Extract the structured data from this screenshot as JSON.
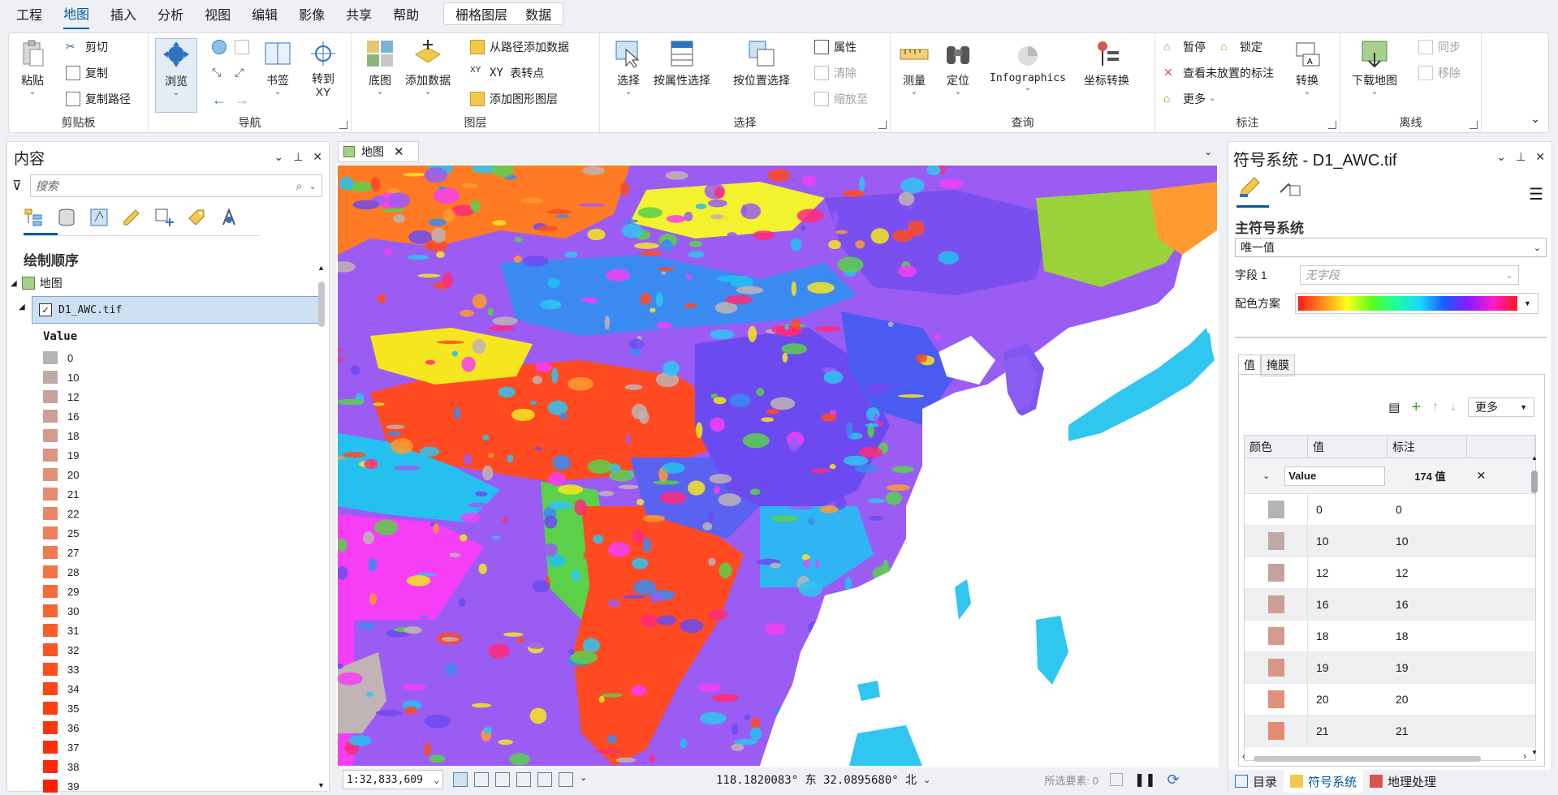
{
  "menubar": {
    "items": [
      "工程",
      "地图",
      "插入",
      "分析",
      "视图",
      "编辑",
      "影像",
      "共享",
      "帮助"
    ],
    "active": "地图",
    "context": [
      "栅格图层",
      "数据"
    ]
  },
  "ribbon": {
    "clipboard": {
      "label": "剪贴板",
      "paste": "粘贴",
      "cut": "剪切",
      "copy": "复制",
      "copy_path": "复制路径"
    },
    "navigate": {
      "label": "导航",
      "explore": "浏览",
      "bookmarks": "书签",
      "goto_xy": "转到\nXY"
    },
    "layer": {
      "label": "图层",
      "basemap": "底图",
      "add_data": "添加数据",
      "add_from_path": "从路径添加数据",
      "xy_to_point": "表转点",
      "add_graphics": "添加图形图层"
    },
    "selection": {
      "label": "选择",
      "select": "选择",
      "by_attr": "按属性选择",
      "by_location": "按位置选择",
      "attributes": "属性",
      "clear": "清除",
      "zoom_to": "缩放至"
    },
    "inquiry": {
      "label": "查询",
      "measure": "测量",
      "locate": "定位",
      "infographics": "Infographics",
      "coord_convert": "坐标转换"
    },
    "labeling": {
      "label": "标注",
      "pause": "暂停",
      "lock": "锁定",
      "unplaced": "查看未放置的标注",
      "more": "更多",
      "convert": "转换"
    },
    "offline": {
      "label": "离线",
      "download": "下载地图",
      "sync": "同步",
      "remove": "移除"
    }
  },
  "contents": {
    "title": "内容",
    "search_placeholder": "搜索",
    "draw_order": "绘制顺序",
    "map_name": "地图",
    "layer_name": "D1_AWC.tif",
    "legend_field": "Value",
    "legend": [
      {
        "value": "0",
        "color": "#b4b4b4"
      },
      {
        "value": "10",
        "color": "#bfa9a6"
      },
      {
        "value": "12",
        "color": "#c5a39d"
      },
      {
        "value": "16",
        "color": "#cc9f96"
      },
      {
        "value": "18",
        "color": "#d39b8d"
      },
      {
        "value": "19",
        "color": "#d99685"
      },
      {
        "value": "20",
        "color": "#e0917a"
      },
      {
        "value": "21",
        "color": "#e48b70"
      },
      {
        "value": "22",
        "color": "#e88666"
      },
      {
        "value": "25",
        "color": "#eb805b"
      },
      {
        "value": "27",
        "color": "#ef7a51"
      },
      {
        "value": "28",
        "color": "#f27347"
      },
      {
        "value": "29",
        "color": "#f46c3e"
      },
      {
        "value": "30",
        "color": "#f66535"
      },
      {
        "value": "31",
        "color": "#f75e2d"
      },
      {
        "value": "32",
        "color": "#f85625"
      },
      {
        "value": "33",
        "color": "#fa4f1e"
      },
      {
        "value": "34",
        "color": "#fb4718"
      },
      {
        "value": "35",
        "color": "#fc3f12"
      },
      {
        "value": "36",
        "color": "#fd370d"
      },
      {
        "value": "37",
        "color": "#fd2f09"
      },
      {
        "value": "38",
        "color": "#fe2706"
      },
      {
        "value": "39",
        "color": "#fe1f03"
      }
    ]
  },
  "map": {
    "tab_label": "地图",
    "scale": "1:32,833,609",
    "coords": "118.1820083° 东  32.0895680° 北",
    "selected_features": "所选要素: 0"
  },
  "symbology": {
    "title": "符号系统 - D1_AWC.tif",
    "primary": "主符号系统",
    "method": "唯一值",
    "field_label": "字段 1",
    "field_value": "无字段",
    "ramp_label": "配色方案",
    "tab_values": "值",
    "tab_mask": "掩膜",
    "more": "更多",
    "col_color": "颜色",
    "col_value": "值",
    "col_label": "标注",
    "group_field": "Value",
    "group_count": "174 值",
    "rows": [
      {
        "value": "0",
        "label": "0",
        "color": "#b4b4b4"
      },
      {
        "value": "10",
        "label": "10",
        "color": "#bfa9a6"
      },
      {
        "value": "12",
        "label": "12",
        "color": "#c5a39d"
      },
      {
        "value": "16",
        "label": "16",
        "color": "#cc9f96"
      },
      {
        "value": "18",
        "label": "18",
        "color": "#d39b8d"
      },
      {
        "value": "19",
        "label": "19",
        "color": "#d99685"
      },
      {
        "value": "20",
        "label": "20",
        "color": "#e0917a"
      },
      {
        "value": "21",
        "label": "21",
        "color": "#e48b70"
      }
    ]
  },
  "bottom_tabs": [
    "目录",
    "符号系统",
    "地理处理"
  ]
}
